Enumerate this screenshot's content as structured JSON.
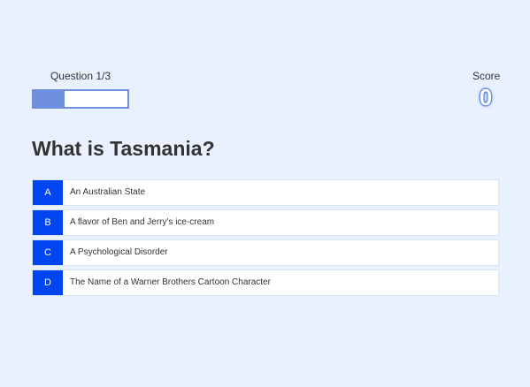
{
  "progress": {
    "text": "Question 1/3",
    "fraction": 0.33
  },
  "score": {
    "label": "Score",
    "value": "0"
  },
  "question": {
    "text": "What is Tasmania?"
  },
  "choices": [
    {
      "letter": "A",
      "text": "An Australian State"
    },
    {
      "letter": "B",
      "text": "A flavor of Ben and Jerry's ice-cream"
    },
    {
      "letter": "C",
      "text": "A Psychological Disorder"
    },
    {
      "letter": "D",
      "text": "The Name of a Warner Brothers Cartoon Character"
    }
  ],
  "colors": {
    "background": "#e8f1fd",
    "accent": "#0045f0",
    "progress": "#6e8fde"
  }
}
